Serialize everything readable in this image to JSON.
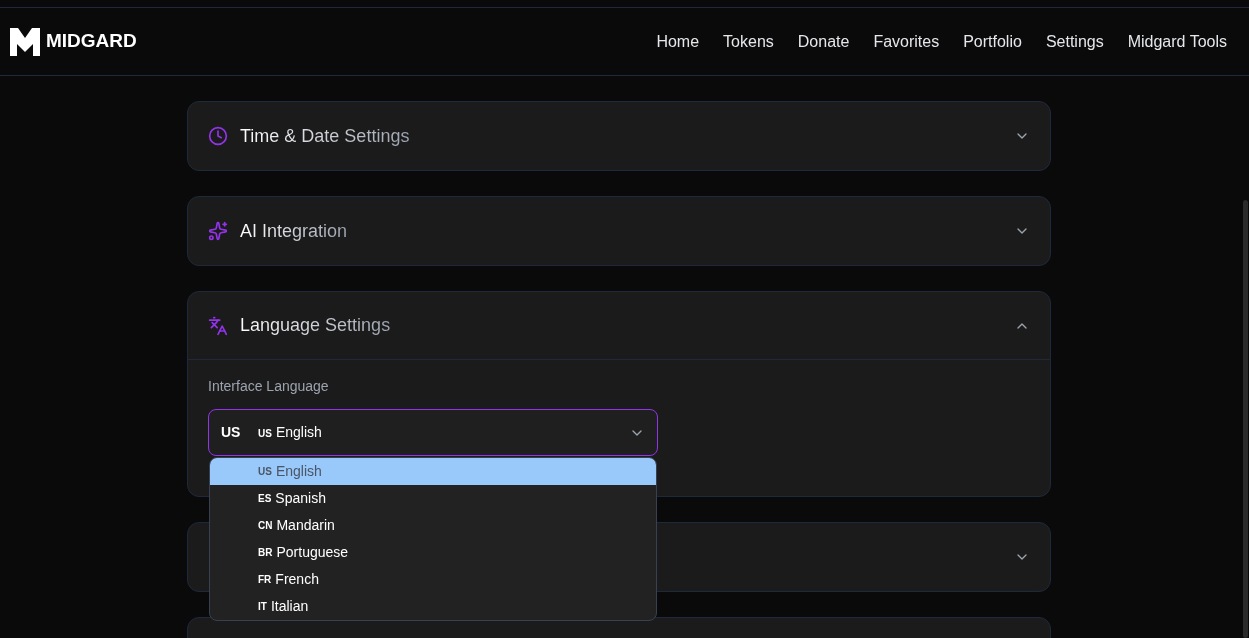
{
  "brand": {
    "name": "MIDGARD"
  },
  "nav": [
    "Home",
    "Tokens",
    "Donate",
    "Favorites",
    "Portfolio",
    "Settings",
    "Midgard Tools"
  ],
  "sections": [
    {
      "kind": "clock",
      "title": "Time & Date Settings",
      "expanded": false
    },
    {
      "kind": "sparkles",
      "title": "AI Integration",
      "expanded": false
    },
    {
      "kind": "language",
      "title": "Language Settings",
      "expanded": true,
      "field_label": "Interface Language",
      "select": {
        "prefix": "US",
        "code": "US",
        "value": "English",
        "open": true
      },
      "options": [
        {
          "code": "US",
          "label": "English",
          "selected": true
        },
        {
          "code": "ES",
          "label": "Spanish",
          "selected": false
        },
        {
          "code": "CN",
          "label": "Mandarin",
          "selected": false
        },
        {
          "code": "BR",
          "label": "Portuguese",
          "selected": false
        },
        {
          "code": "FR",
          "label": "French",
          "selected": false
        },
        {
          "code": "IT",
          "label": "Italian",
          "selected": false
        }
      ]
    },
    {
      "kind": "blank",
      "expanded": false
    },
    {
      "kind": "blank"
    }
  ]
}
